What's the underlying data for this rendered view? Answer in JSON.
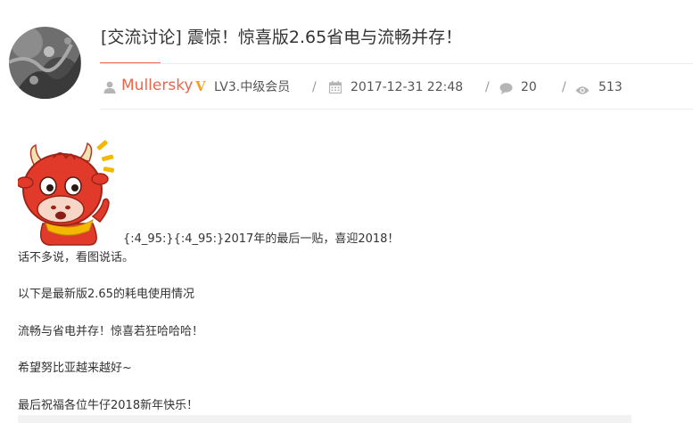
{
  "post": {
    "title": "[交流讨论] 震惊！惊喜版2.65省电与流畅并存！",
    "author": {
      "name": "Mullersky",
      "vip_badge": "V",
      "level": "LV3.中级会员"
    },
    "date": "2017-12-31 22:48",
    "separator": "/",
    "replies": "20",
    "views": "513",
    "emote_line": "{:4_95:}{:4_95:}2017年的最后一贴，喜迎2018！",
    "body_lines": [
      "话不多说，看图说话。",
      "以下是最新版2.65的耗电使用情况",
      "流畅与省电并存！惊喜若狂哈哈哈！",
      "希望努比亚越来越好~",
      "最后祝福各位牛仔2018新年快乐！"
    ]
  },
  "icons": {
    "author": "user-icon",
    "date": "calendar-icon",
    "replies": "comment-icon",
    "views": "eye-icon"
  },
  "colors": {
    "accent": "#e8674a",
    "vip": "#f1a325",
    "icon_gray": "#b5b5b5",
    "text": "#333333"
  }
}
